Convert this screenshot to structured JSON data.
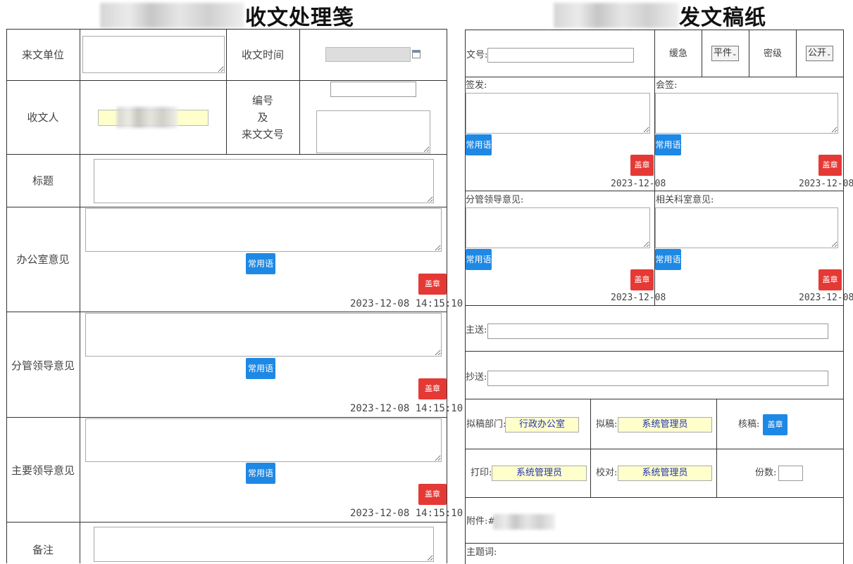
{
  "left": {
    "title": "收文处理笺",
    "labels": {
      "source_unit": "来文单位",
      "receive_time": "收文时间",
      "receiver": "收文人",
      "number_line1": "编号",
      "number_line2": "及",
      "number_line3": "来文文号",
      "subject": "标题",
      "office_opinion": "办公室意见",
      "deputy_opinion": "分管领导意见",
      "main_opinion": "主要领导意见",
      "remarks": "备注"
    },
    "common_phrase_label": "常用语",
    "seal_label": "盖章",
    "timestamp": "2023-12-08 14:15:10"
  },
  "right": {
    "title": "发文稿纸",
    "doc_no_label": "文号:",
    "urgency_label": "缓急",
    "urgency_value": "平件",
    "secrecy_label": "密级",
    "secrecy_value": "公开",
    "sign_label": "签发:",
    "countersign_label": "会签:",
    "deputy_label": "分管领导意见:",
    "dept_label": "相关科室意见:",
    "common_phrase_label": "常用语",
    "seal_label": "盖章",
    "date": "2023-12-08",
    "main_send_label": "主送:",
    "copy_send_label": "抄送:",
    "draft_dept_label": "拟稿部门:",
    "draft_dept_value": "行政办公室",
    "drafter_label": "拟稿:",
    "drafter_value": "系统管理员",
    "checker_label": "核稿:",
    "print_label": "打印:",
    "print_value": "系统管理员",
    "proof_label": "校对:",
    "proof_value": "系统管理员",
    "copies_label": "份数:",
    "attachment_label": "附件:#",
    "keywords_label": "主题词:"
  },
  "icons": {
    "calendar": "calendar-icon",
    "dropdown": "chevron-down-icon"
  }
}
